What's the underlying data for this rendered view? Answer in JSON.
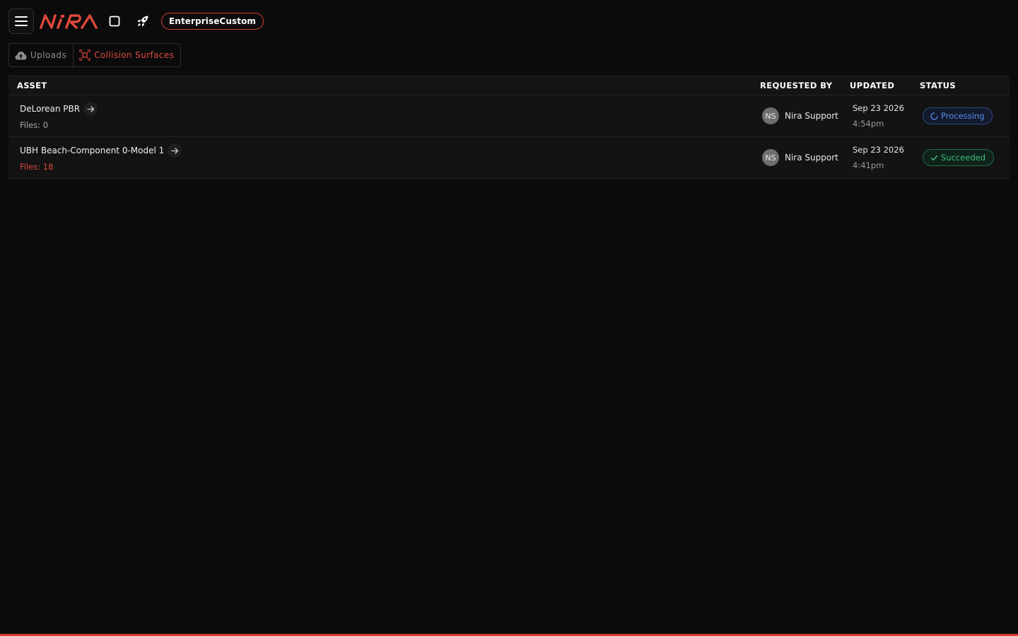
{
  "header": {
    "plan_badge": "EnterpriseCustom",
    "logo_text": "NiRA",
    "brand_color": "#e0483d"
  },
  "tabs": [
    {
      "label": "Uploads",
      "icon": "cloud-upload-icon",
      "active": false
    },
    {
      "label": "Collision Surfaces",
      "icon": "collision-icon",
      "active": true
    }
  ],
  "table": {
    "columns": [
      "ASSET",
      "REQUESTED BY",
      "UPDATED",
      "STATUS"
    ],
    "rows": [
      {
        "asset": "DeLorean PBR",
        "files": "Files: 0",
        "avatar": "NS",
        "requested_by": "Nira Support",
        "date": "Sep 23 2026",
        "time": "4:54pm",
        "status": "Processing"
      },
      {
        "asset": "UBH Beach-Component 0-Model 1",
        "files": "Files: 18",
        "avatar": "NS",
        "requested_by": "Nira Support",
        "date": "Sep 23 2026",
        "time": "4:41pm",
        "status": "Succeeded"
      }
    ]
  },
  "colors": {
    "processing": "#5a8cf0",
    "succeeded": "#3fbf7f",
    "accent": "#d63a2f"
  }
}
